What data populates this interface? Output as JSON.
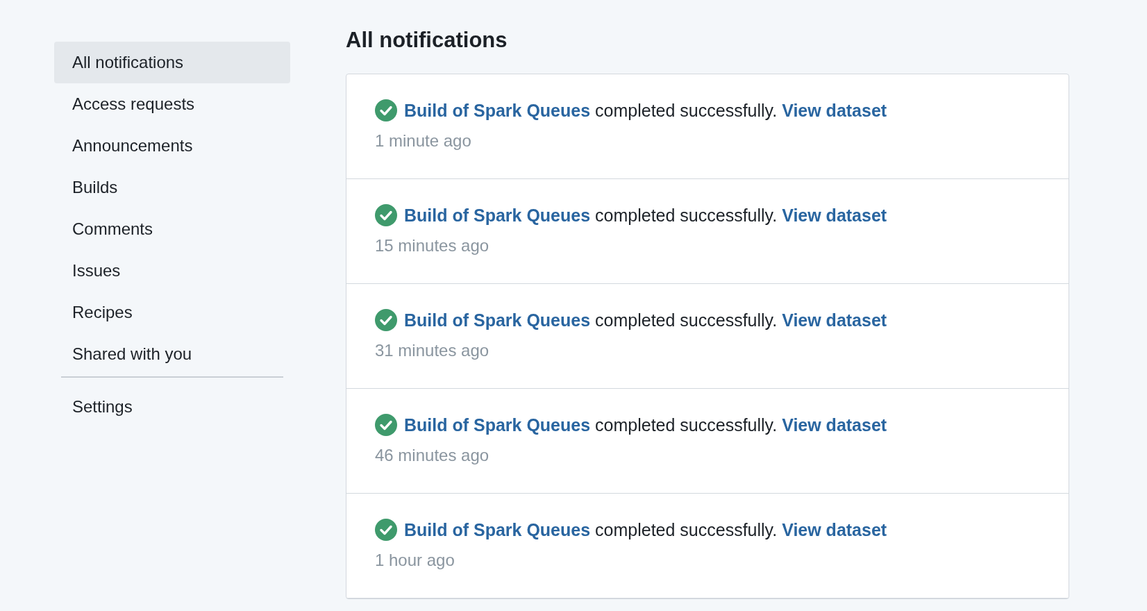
{
  "sidebar": {
    "items": [
      {
        "label": "All notifications",
        "selected": true
      },
      {
        "label": "Access requests",
        "selected": false
      },
      {
        "label": "Announcements",
        "selected": false
      },
      {
        "label": "Builds",
        "selected": false
      },
      {
        "label": "Comments",
        "selected": false
      },
      {
        "label": "Issues",
        "selected": false
      },
      {
        "label": "Recipes",
        "selected": false
      },
      {
        "label": "Shared with you",
        "selected": false
      }
    ],
    "footer_item": {
      "label": "Settings"
    }
  },
  "main": {
    "title": "All notifications",
    "notifications": [
      {
        "subject": "Build of Spark Queues",
        "message": "completed successfully.",
        "action": "View dataset",
        "time": "1 minute ago"
      },
      {
        "subject": "Build of Spark Queues",
        "message": "completed successfully.",
        "action": "View dataset",
        "time": "15 minutes ago"
      },
      {
        "subject": "Build of Spark Queues",
        "message": "completed successfully.",
        "action": "View dataset",
        "time": "31 minutes ago"
      },
      {
        "subject": "Build of Spark Queues",
        "message": "completed successfully.",
        "action": "View dataset",
        "time": "46 minutes ago"
      },
      {
        "subject": "Build of Spark Queues",
        "message": "completed successfully.",
        "action": "View dataset",
        "time": "1 hour ago"
      }
    ]
  }
}
